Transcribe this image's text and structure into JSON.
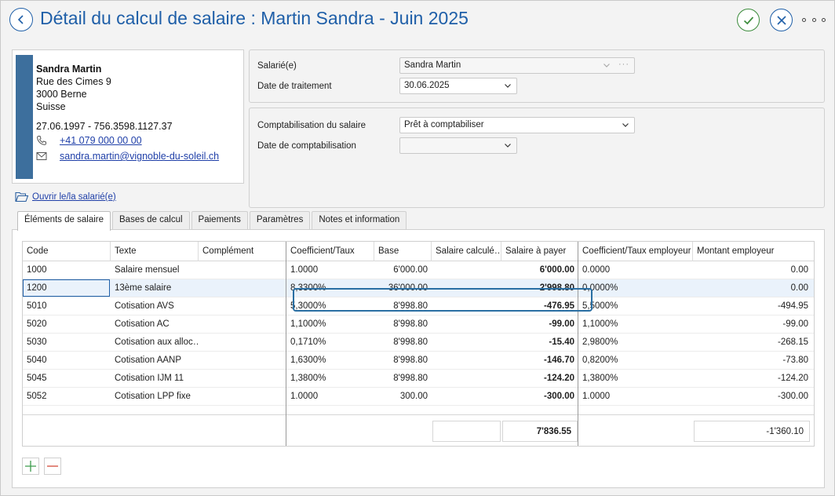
{
  "title": "Détail du calcul de salaire : Martin Sandra - Juin 2025",
  "employee_card": {
    "name": "Sandra Martin",
    "street": "Rue des Cimes 9",
    "city": "3000 Berne",
    "country": "Suisse",
    "birth_and_avs": "27.06.1997 - 756.3598.1127.37",
    "phone": "+41 079 000 00 00",
    "email": "sandra.martin@vignoble-du-soleil.ch",
    "bar_color": "#3d6f9d"
  },
  "open_employee_link": "Ouvrir le/la salarié(e)",
  "form": {
    "employee_label": "Salarié(e)",
    "employee_value": "Sandra Martin",
    "processing_date_label": "Date de traitement",
    "processing_date_value": "30.06.2025",
    "accounting_label": "Comptabilisation du salaire",
    "accounting_value": "Prêt à comptabiliser",
    "accounting_date_label": "Date de comptabilisation",
    "accounting_date_value": ""
  },
  "tabs": [
    {
      "label": "Éléments de salaire",
      "active": true
    },
    {
      "label": "Bases de calcul",
      "active": false
    },
    {
      "label": "Paiements",
      "active": false
    },
    {
      "label": "Paramètres",
      "active": false
    },
    {
      "label": "Notes et information",
      "active": false
    }
  ],
  "grid": {
    "columns": [
      "Code",
      "Texte",
      "Complément",
      "Coefficient/Taux",
      "Base",
      "Salaire calculé…",
      "Salaire à payer",
      "Coefficient/Taux employeur",
      "Montant employeur"
    ],
    "rows": [
      {
        "code": "1000",
        "text": "Salaire mensuel",
        "complement": "",
        "coef": "1.0000",
        "base": "6'000.00",
        "calc": "",
        "pay": "6'000.00",
        "coef_emp": "0.0000",
        "amount_emp": "0.00"
      },
      {
        "code": "1200",
        "text": "13ème salaire",
        "complement": "",
        "coef": "8,3300%",
        "base": "36'000.00",
        "calc": "",
        "pay": "2'998.80",
        "coef_emp": "0,0000%",
        "amount_emp": "0.00"
      },
      {
        "code": "5010",
        "text": "Cotisation AVS",
        "complement": "",
        "coef": "5,3000%",
        "base": "8'998.80",
        "calc": "",
        "pay": "-476.95",
        "coef_emp": "5,5000%",
        "amount_emp": "-494.95"
      },
      {
        "code": "5020",
        "text": "Cotisation AC",
        "complement": "",
        "coef": "1,1000%",
        "base": "8'998.80",
        "calc": "",
        "pay": "-99.00",
        "coef_emp": "1,1000%",
        "amount_emp": "-99.00"
      },
      {
        "code": "5030",
        "text": "Cotisation aux alloc…",
        "complement": "",
        "coef": "0,1710%",
        "base": "8'998.80",
        "calc": "",
        "pay": "-15.40",
        "coef_emp": "2,9800%",
        "amount_emp": "-268.15"
      },
      {
        "code": "5040",
        "text": "Cotisation AANP",
        "complement": "",
        "coef": "1,6300%",
        "base": "8'998.80",
        "calc": "",
        "pay": "-146.70",
        "coef_emp": "0,8200%",
        "amount_emp": "-73.80"
      },
      {
        "code": "5045",
        "text": "Cotisation IJM 11",
        "complement": "",
        "coef": "1,3800%",
        "base": "8'998.80",
        "calc": "",
        "pay": "-124.20",
        "coef_emp": "1,3800%",
        "amount_emp": "-124.20"
      },
      {
        "code": "5052",
        "text": "Cotisation LPP fixe",
        "complement": "",
        "coef": "1.0000",
        "base": "300.00",
        "calc": "",
        "pay": "-300.00",
        "coef_emp": "1.0000",
        "amount_emp": "-300.00"
      }
    ],
    "totals": {
      "calc": "",
      "pay": "7'836.55",
      "amount_emp": "-1'360.10"
    }
  }
}
